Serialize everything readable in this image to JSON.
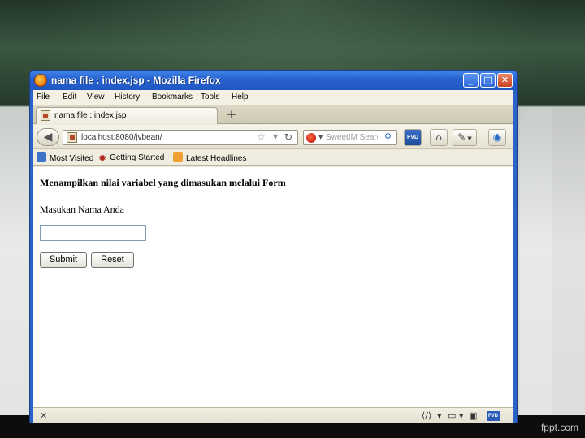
{
  "window": {
    "title": "nama file : index.jsp - Mozilla Firefox"
  },
  "menu": [
    "File",
    "Edit",
    "View",
    "History",
    "Bookmarks",
    "Tools",
    "Help"
  ],
  "tab": {
    "label": "nama file : index.jsp",
    "new_tab": "+"
  },
  "navigation": {
    "url": "localhost:8080/jvbean/",
    "search_placeholder": "SweetIM Search",
    "fvd_label": "FVD"
  },
  "bookmarks": [
    "Most Visited",
    "Getting Started",
    "Latest Headlines"
  ],
  "page": {
    "heading": "Menampilkan nilai variabel yang dimasukan melalui Form",
    "prompt": "Masukan Nama Anda",
    "name_value": "",
    "submit_label": "Submit",
    "reset_label": "Reset"
  },
  "statusbar": {
    "fvd_label": "FVD"
  },
  "footer": {
    "brand": "fppt.com"
  }
}
